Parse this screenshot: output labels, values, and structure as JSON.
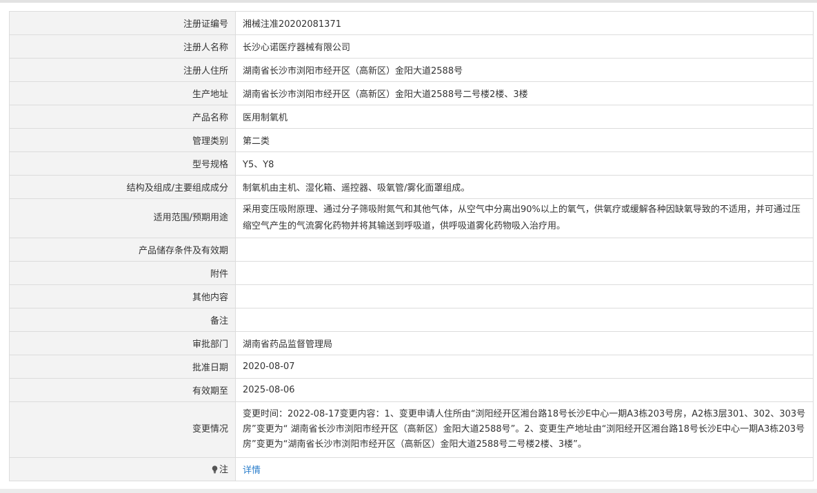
{
  "rows": [
    {
      "label": "注册证编号",
      "value": "湘械注准20202081371"
    },
    {
      "label": "注册人名称",
      "value": "长沙心诺医疗器械有限公司"
    },
    {
      "label": "注册人住所",
      "value": "湖南省长沙市浏阳市经开区（高新区）金阳大道2588号"
    },
    {
      "label": "生产地址",
      "value": "湖南省长沙市浏阳市经开区（高新区）金阳大道2588号二号楼2楼、3楼"
    },
    {
      "label": "产品名称",
      "value": "医用制氧机"
    },
    {
      "label": "管理类别",
      "value": "第二类"
    },
    {
      "label": "型号规格",
      "value": "Y5、Y8"
    },
    {
      "label": "结构及组成/主要组成成分",
      "value": "制氧机由主机、湿化箱、遥控器、吸氧管/雾化面罩组成。"
    },
    {
      "label": "适用范围/预期用途",
      "value": "采用变压吸附原理、通过分子筛吸附氮气和其他气体，从空气中分离出90%以上的氧气，供氧疗或缓解各种因缺氧导致的不适用，并可通过压缩空气产生的气流雾化药物并将其输送到呼吸道，供呼吸道雾化药物吸入治疗用。"
    },
    {
      "label": "产品储存条件及有效期",
      "value": ""
    },
    {
      "label": "附件",
      "value": ""
    },
    {
      "label": "其他内容",
      "value": ""
    },
    {
      "label": "备注",
      "value": ""
    },
    {
      "label": "审批部门",
      "value": "湖南省药品监督管理局"
    },
    {
      "label": "批准日期",
      "value": "2020-08-07"
    },
    {
      "label": "有效期至",
      "value": "2025-08-06"
    },
    {
      "label": "变更情况",
      "value": "变更时间：2022-08-17变更内容：1、变更申请人住所由“浏阳经开区湘台路18号长沙E中心一期A3栋203号房，A2栋3层301、302、303号房”变更为“ 湖南省长沙市浏阳市经开区（高新区）金阳大道2588号”。2、变更生产地址由“浏阳经开区湘台路18号长沙E中心一期A3栋203号房”变更为“湖南省长沙市浏阳市经开区（高新区）金阳大道2588号二号楼2楼、3楼”。"
    }
  ],
  "note": {
    "label": "注",
    "icon": "lightbulb-icon",
    "link_text": "详情"
  }
}
